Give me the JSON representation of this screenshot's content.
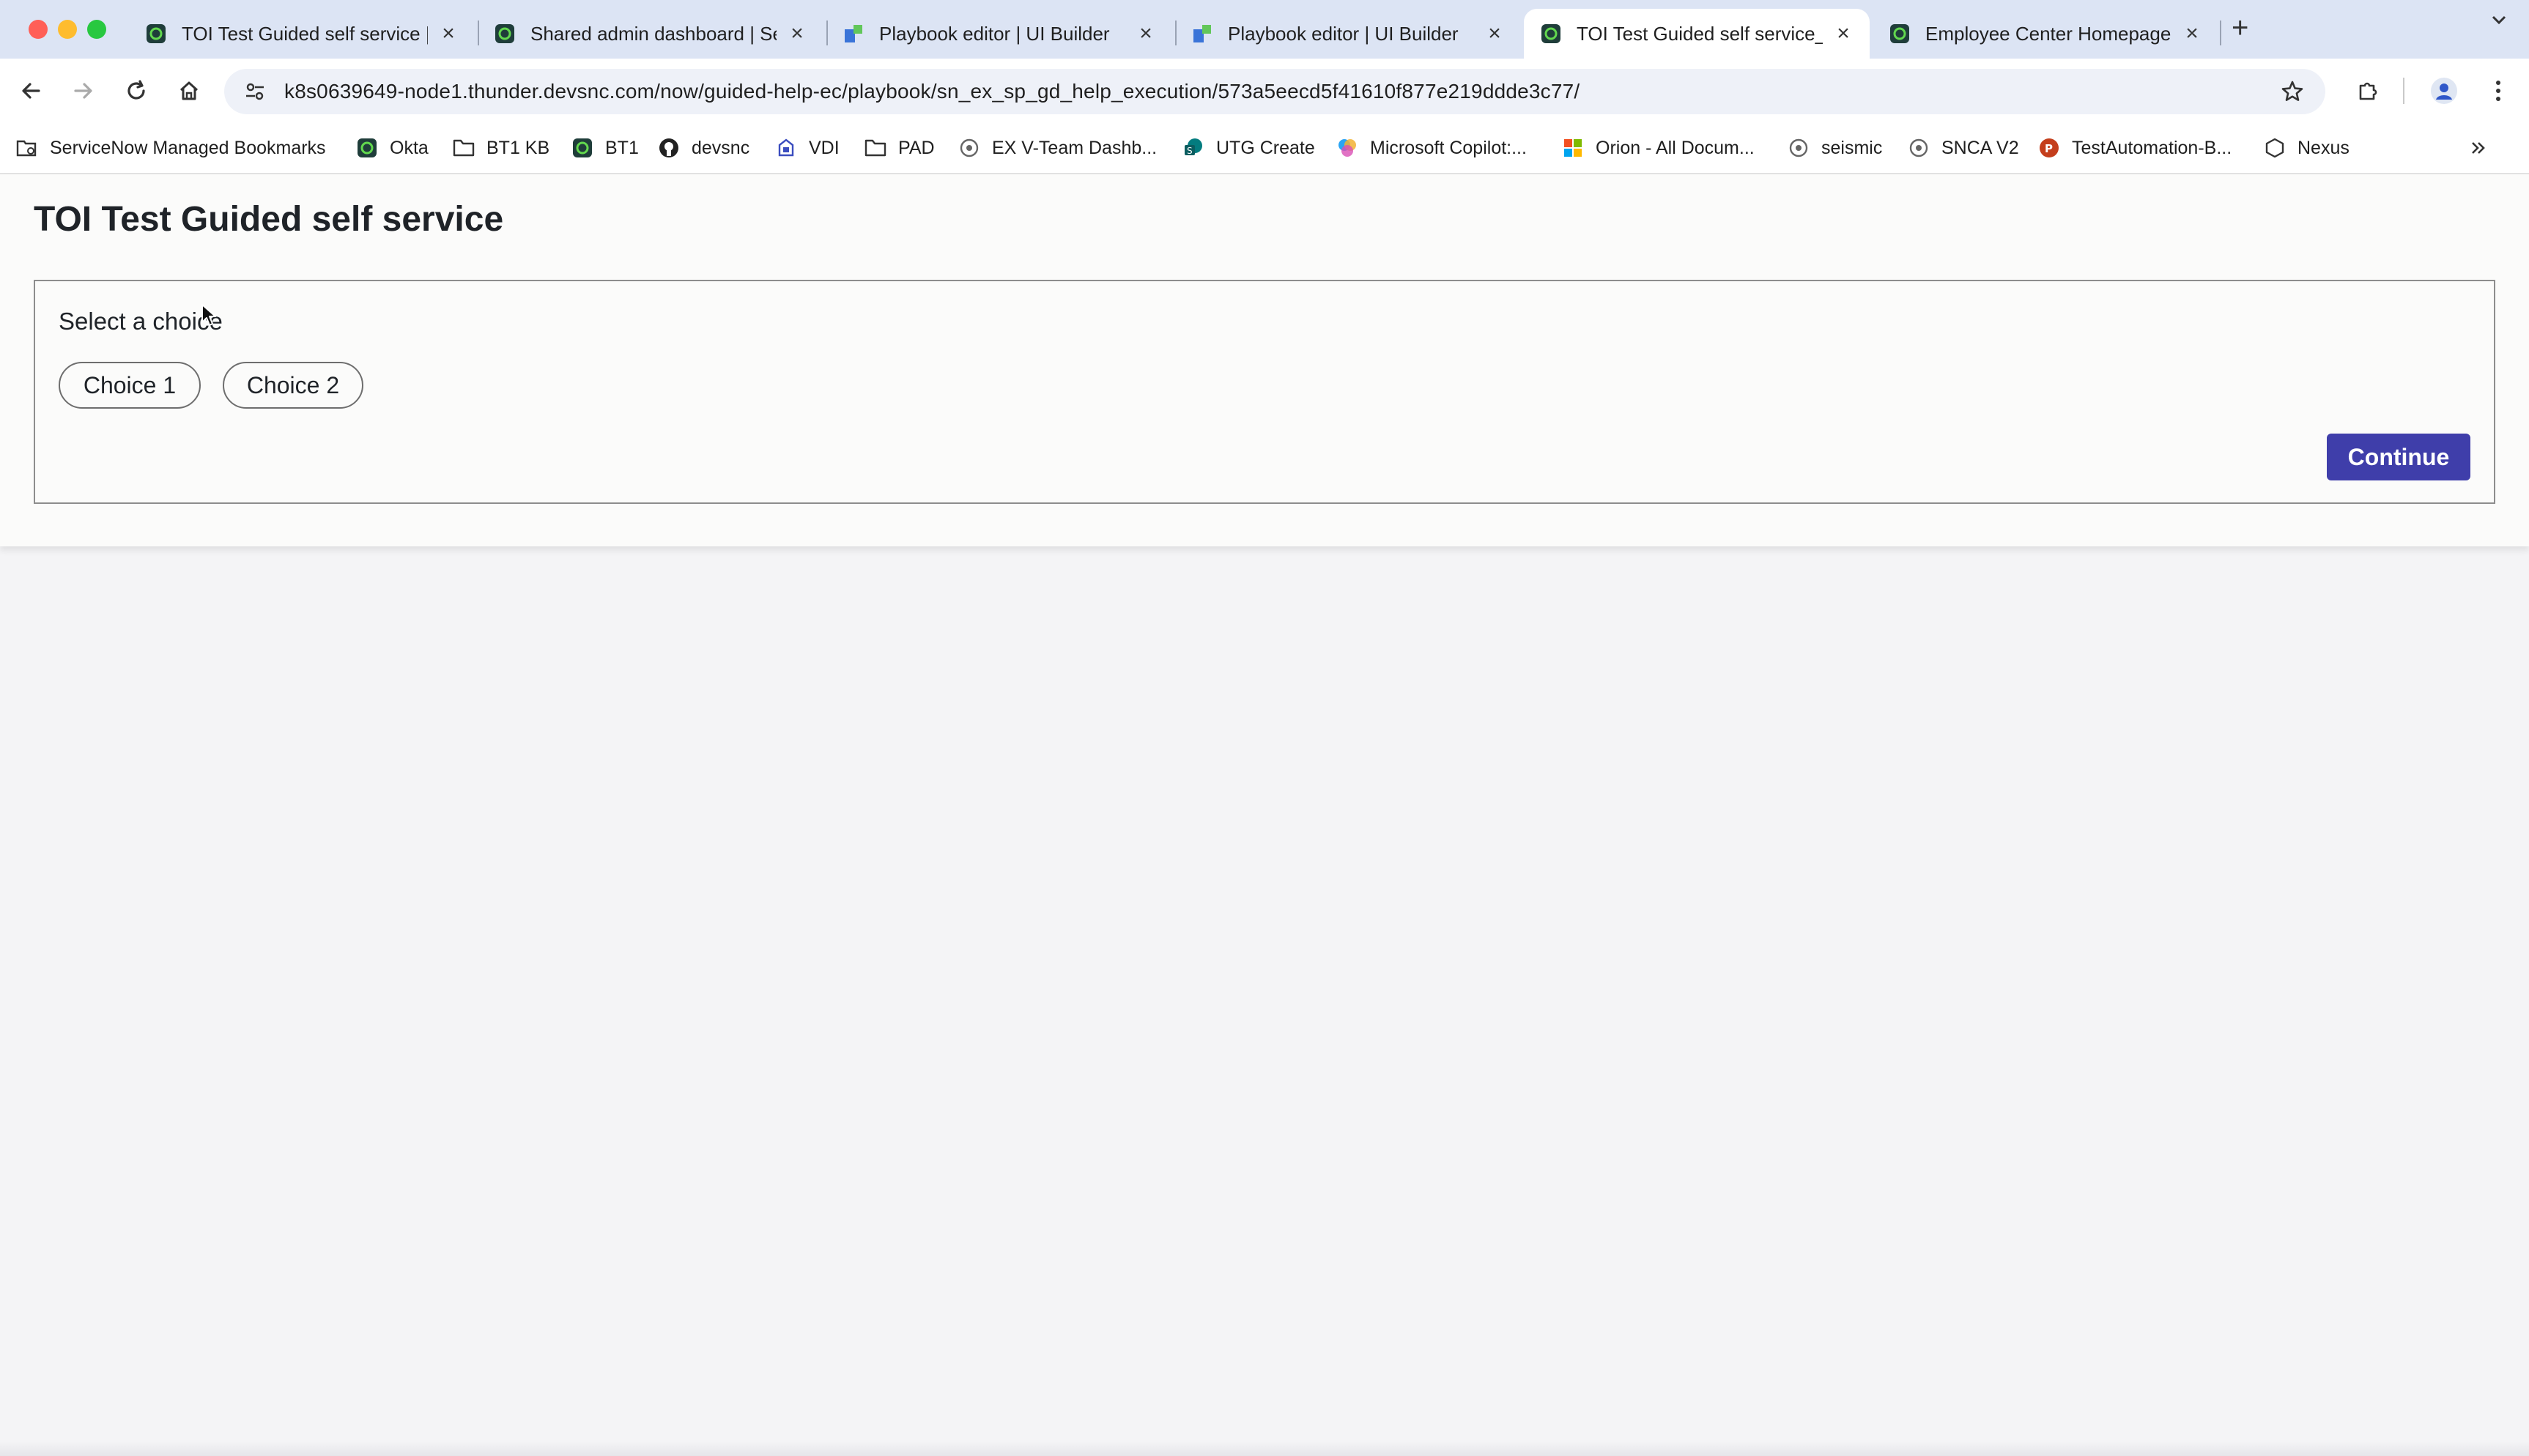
{
  "browser": {
    "tabs": [
      {
        "title": "TOI Test Guided self service |",
        "icon": "servicenow-icon",
        "active": false
      },
      {
        "title": "Shared admin dashboard | Se",
        "icon": "servicenow-icon",
        "active": false
      },
      {
        "title": "Playbook editor | UI Builder",
        "icon": "ui-builder-icon",
        "active": false
      },
      {
        "title": "Playbook editor | UI Builder",
        "icon": "ui-builder-icon",
        "active": false
      },
      {
        "title": "TOI Test Guided self service_",
        "icon": "servicenow-icon",
        "active": true
      },
      {
        "title": "Employee Center Homepage",
        "icon": "servicenow-icon",
        "active": false
      }
    ],
    "url": "k8s0639649-node1.thunder.devsnc.com/now/guided-help-ec/playbook/sn_ex_sp_gd_help_execution/573a5eecd5f41610f877e219ddde3c77/",
    "bookmarks": [
      {
        "label": "ServiceNow Managed Bookmarks",
        "icon": "managed-bookmarks-icon"
      },
      {
        "label": "Okta",
        "icon": "servicenow-icon"
      },
      {
        "label": "BT1 KB",
        "icon": "folder-icon"
      },
      {
        "label": "BT1",
        "icon": "servicenow-icon"
      },
      {
        "label": "devsnc",
        "icon": "github-icon"
      },
      {
        "label": "VDI",
        "icon": "vdi-icon"
      },
      {
        "label": "PAD",
        "icon": "folder-icon"
      },
      {
        "label": "EX V-Team Dashb...",
        "icon": "globe-icon"
      },
      {
        "label": "UTG Create",
        "icon": "sharepoint-icon"
      },
      {
        "label": "Microsoft Copilot:...",
        "icon": "copilot-icon"
      },
      {
        "label": "Orion - All Docum...",
        "icon": "microsoft-icon"
      },
      {
        "label": "seismic",
        "icon": "globe-icon"
      },
      {
        "label": "SNCA V2",
        "icon": "globe-icon"
      },
      {
        "label": "TestAutomation-B...",
        "icon": "powerpoint-icon"
      },
      {
        "label": "Nexus",
        "icon": "nexus-icon"
      }
    ]
  },
  "page": {
    "title": "TOI Test Guided self service",
    "prompt": "Select a choice",
    "choices": [
      "Choice 1",
      "Choice 2"
    ],
    "continue_label": "Continue"
  },
  "colors": {
    "accent": "#3f3eaa",
    "servicenow_green": "#293e40"
  }
}
